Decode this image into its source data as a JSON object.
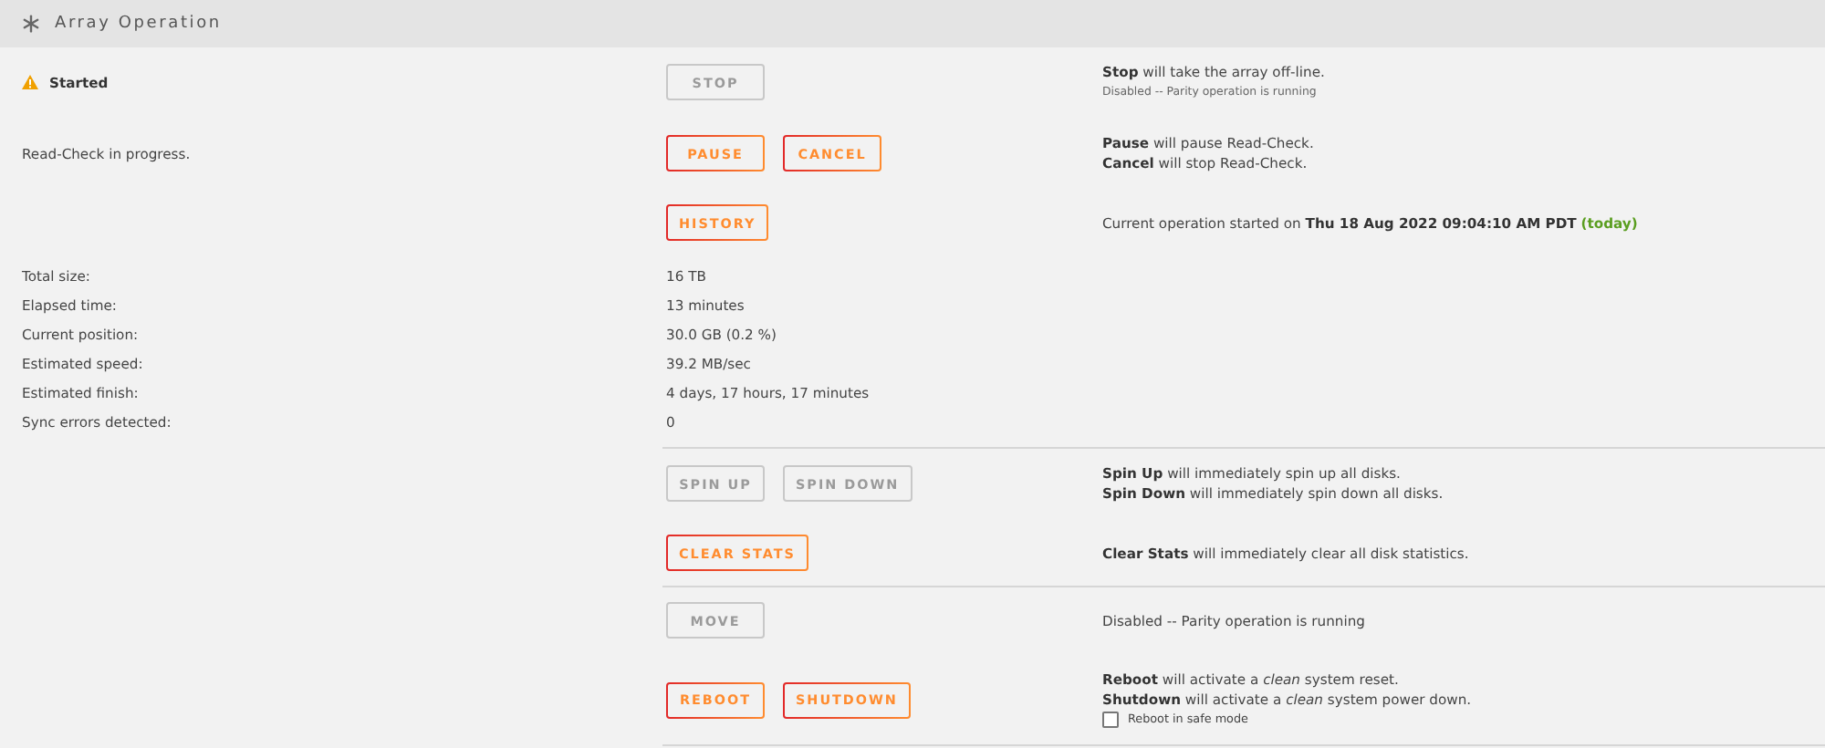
{
  "header": {
    "title": "Array Operation"
  },
  "rows": [
    {
      "kind": "action",
      "label": {
        "kind": "status",
        "text": "Started"
      },
      "buttons": [
        {
          "label": "STOP",
          "disabled": true
        }
      ],
      "notes": [
        {
          "kind": "line",
          "text": "**Stop** will take the array off-line."
        },
        {
          "kind": "small",
          "text": "Disabled -- Parity operation is running"
        }
      ],
      "divider_below": false
    },
    {
      "kind": "action",
      "label": {
        "kind": "plain",
        "text": "Read-Check in progress."
      },
      "buttons": [
        {
          "label": "PAUSE",
          "disabled": false
        },
        {
          "label": "CANCEL",
          "disabled": false
        }
      ],
      "notes": [
        {
          "kind": "line",
          "text": "**Pause** will pause Read-Check."
        },
        {
          "kind": "line",
          "text": "**Cancel** will stop Read-Check."
        }
      ],
      "divider_below": false
    },
    {
      "kind": "action",
      "buttons": [
        {
          "label": "HISTORY",
          "disabled": false
        }
      ],
      "notes": [
        {
          "kind": "line",
          "text": "Current operation started on **Thu 18 Aug 2022 09:04:10 AM PDT**",
          "highlight": "(today)"
        }
      ],
      "divider_below": false
    },
    {
      "kind": "stats",
      "items": [
        {
          "label": "Total size:",
          "value": "16 TB"
        },
        {
          "label": "Elapsed time:",
          "value": "13 minutes"
        },
        {
          "label": "Current position:",
          "value": "30.0 GB (0.2 %)"
        },
        {
          "label": "Estimated speed:",
          "value": "39.2 MB/sec"
        },
        {
          "label": "Estimated finish:",
          "value": "4 days, 17 hours, 17 minutes"
        },
        {
          "label": "Sync errors detected:",
          "value": "0"
        }
      ],
      "divider_below": true
    },
    {
      "kind": "action",
      "buttons": [
        {
          "label": "SPIN UP",
          "disabled": true
        },
        {
          "label": "SPIN DOWN",
          "disabled": true
        }
      ],
      "notes": [
        {
          "kind": "line",
          "text": "**Spin Up** will immediately spin up all disks."
        },
        {
          "kind": "line",
          "text": "**Spin Down** will immediately spin down all disks."
        }
      ],
      "divider_below": false
    },
    {
      "kind": "action",
      "buttons": [
        {
          "label": "CLEAR STATS",
          "disabled": false
        }
      ],
      "notes": [
        {
          "kind": "line",
          "text": "**Clear Stats** will immediately clear all disk statistics."
        }
      ],
      "divider_below": true
    },
    {
      "kind": "action",
      "buttons": [
        {
          "label": "MOVE",
          "disabled": true
        }
      ],
      "notes": [
        {
          "kind": "line",
          "text": "Disabled -- Parity operation is running"
        }
      ],
      "divider_below": false
    },
    {
      "kind": "action",
      "buttons": [
        {
          "label": "REBOOT",
          "disabled": false
        },
        {
          "label": "SHUTDOWN",
          "disabled": false
        }
      ],
      "notes": [
        {
          "kind": "line",
          "text": "**Reboot** will activate a *clean* system reset."
        },
        {
          "kind": "line",
          "text": "**Shutdown** will activate a *clean* system power down."
        },
        {
          "kind": "checkbox",
          "text": "Reboot in safe mode",
          "checked": false
        }
      ],
      "divider_below": true
    }
  ]
}
